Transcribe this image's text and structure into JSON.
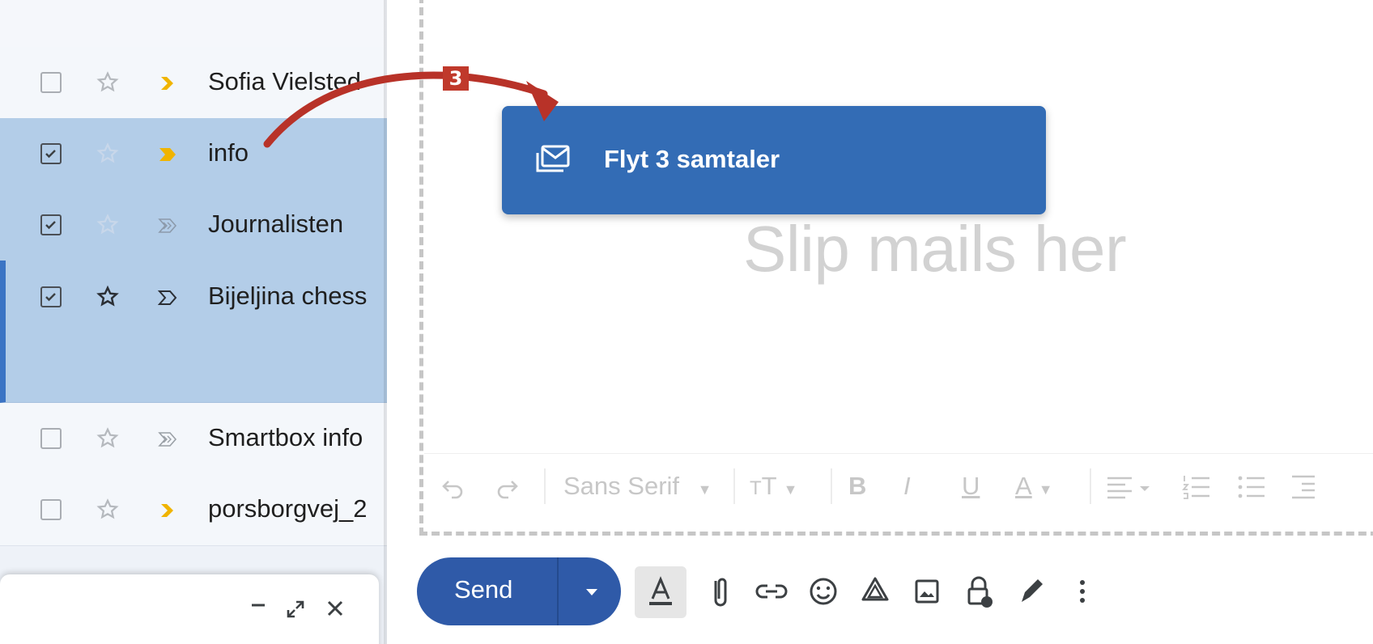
{
  "inbox": {
    "rows": [
      {
        "sender": "Sofia Vielsted",
        "checked": false,
        "important": "yellow",
        "selected": false
      },
      {
        "sender": "info",
        "checked": true,
        "important": "yellow",
        "selected": true
      },
      {
        "sender": "Journalisten",
        "checked": true,
        "important": "gray",
        "selected": true
      },
      {
        "sender": "Bijeljina chess",
        "checked": true,
        "important": "outline",
        "selected": true
      },
      {
        "sender": "Smartbox info",
        "checked": false,
        "important": "gray",
        "selected": false
      },
      {
        "sender": "porsborgvej_2",
        "checked": false,
        "important": "yellow",
        "selected": false
      }
    ]
  },
  "drag_tooltip": {
    "label": "Flyt 3 samtaler",
    "icon": "move-to-inbox-icon"
  },
  "drop_zone": {
    "text": "Slip mails her"
  },
  "format_toolbar": {
    "font": "Sans Serif",
    "undo_icon": "undo-icon",
    "redo_icon": "redo-icon",
    "size_icon": "text-size-icon",
    "bold": "B",
    "italic": "I",
    "underline": "U",
    "text_color": "A"
  },
  "compose_actions": {
    "send_label": "Send",
    "icons": [
      "text-format-icon",
      "attach-icon",
      "link-icon",
      "emoji-icon",
      "drive-icon",
      "photo-icon",
      "confidential-icon",
      "signature-icon",
      "more-options-icon"
    ]
  },
  "annotation": {
    "step": "3"
  },
  "colors": {
    "accent": "#336cb5",
    "selected_row": "#b3cde8",
    "annotation": "#c0392b",
    "important_yellow": "#f0b400"
  }
}
